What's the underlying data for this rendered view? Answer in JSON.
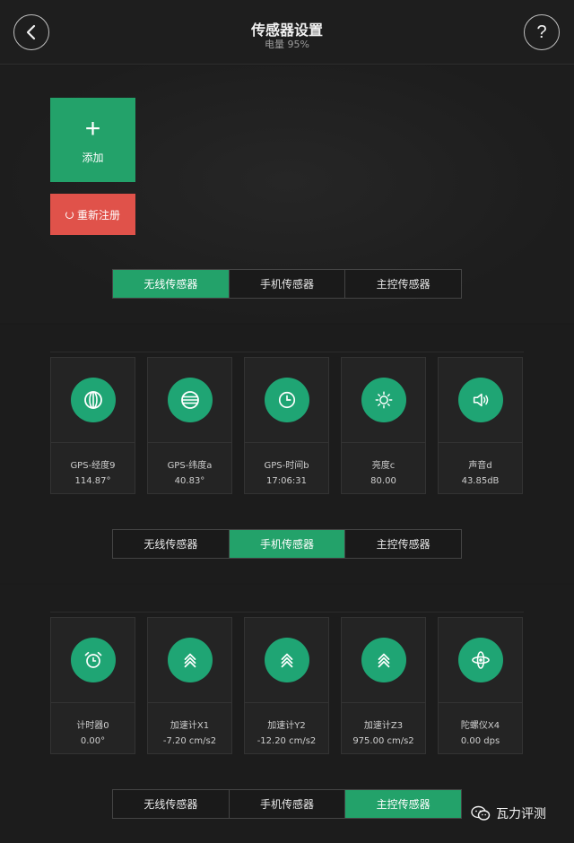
{
  "header": {
    "title": "传感器设置",
    "subtitle": "电量 95%",
    "back_icon": "chevron-left-icon",
    "help_label": "?"
  },
  "actions": {
    "add_label": "添加",
    "add_symbol": "+",
    "reregister_label": "重新注册"
  },
  "tab_sets": [
    {
      "tabs": [
        "无线传感器",
        "手机传感器",
        "主控传感器"
      ],
      "active": 0
    },
    {
      "tabs": [
        "无线传感器",
        "手机传感器",
        "主控传感器"
      ],
      "active": 1
    },
    {
      "tabs": [
        "无线传感器",
        "手机传感器",
        "主控传感器"
      ],
      "active": 2
    }
  ],
  "phone_sensors": [
    {
      "name": "GPS-经度9",
      "value": "114.87°",
      "icon": "globe-longitude-icon"
    },
    {
      "name": "GPS-纬度a",
      "value": "40.83°",
      "icon": "globe-latitude-icon"
    },
    {
      "name": "GPS-时间b",
      "value": "17:06:31",
      "icon": "clock-icon"
    },
    {
      "name": "亮度c",
      "value": "80.00",
      "icon": "sun-icon"
    },
    {
      "name": "声音d",
      "value": "43.85dB",
      "icon": "speaker-icon"
    }
  ],
  "main_sensors": [
    {
      "name": "计时器0",
      "value": "0.00°",
      "icon": "alarm-clock-icon"
    },
    {
      "name": "加速计X1",
      "value": "-7.20 cm/s2",
      "icon": "chevrons-up-icon"
    },
    {
      "name": "加速计Y2",
      "value": "-12.20 cm/s2",
      "icon": "chevrons-up-icon"
    },
    {
      "name": "加速计Z3",
      "value": "975.00 cm/s2",
      "icon": "chevrons-up-icon"
    },
    {
      "name": "陀螺仪X4",
      "value": "0.00 dps",
      "icon": "gyroscope-icon"
    }
  ],
  "watermark": {
    "text": "瓦力评测",
    "icon": "wechat-icon"
  },
  "colors": {
    "accent": "#23a26a",
    "icon_bg": "#1fa574",
    "danger": "#e0524a",
    "background": "#1b1b1b"
  }
}
